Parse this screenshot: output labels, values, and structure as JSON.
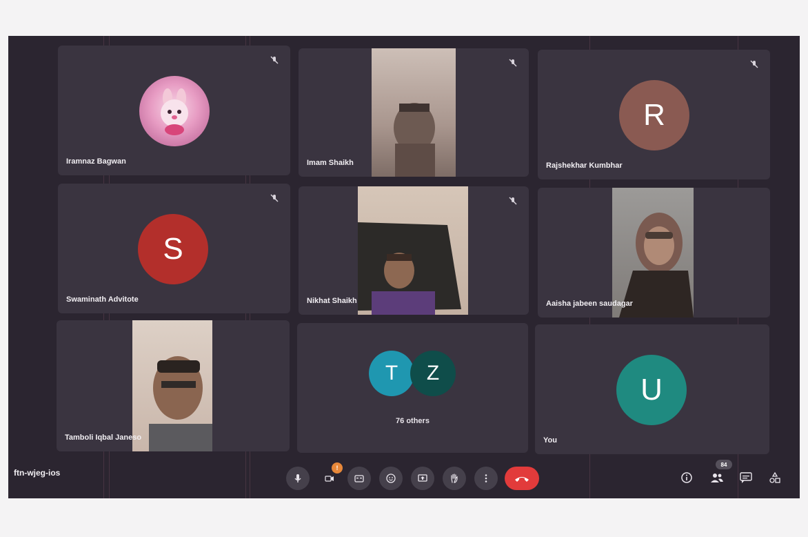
{
  "meeting_code": "ftn-wjeg-ios",
  "participants": [
    {
      "name": "Iramnaz Bagwan",
      "type": "image-avatar",
      "muted": true
    },
    {
      "name": "Imam Shaikh",
      "type": "video",
      "muted": true
    },
    {
      "name": "Rajshekhar Kumbhar",
      "type": "letter-avatar",
      "letter": "R",
      "color": "#8a5a52",
      "muted": true
    },
    {
      "name": "Swaminath Advitote",
      "type": "letter-avatar",
      "letter": "S",
      "color": "#b32f2b",
      "muted": true
    },
    {
      "name": "Nikhat Shaikh",
      "type": "video",
      "muted": true
    },
    {
      "name": "Aaisha jabeen saudagar",
      "type": "video",
      "muted": false
    },
    {
      "name": "Tamboli Iqbal Janeso",
      "type": "video",
      "muted": false
    },
    {
      "name": "You",
      "type": "letter-avatar",
      "letter": "U",
      "color": "#1f8a80",
      "muted": false
    }
  ],
  "others_tile": {
    "letters": [
      "T",
      "Z"
    ],
    "colors": [
      "#1f97b0",
      "#0f4d4a"
    ],
    "label": "76 others"
  },
  "controls": {
    "camera_badge": "!",
    "people_count": "84",
    "icons": [
      "mic-icon",
      "camera-off-icon",
      "captions-icon",
      "emoji-icon",
      "present-icon",
      "raise-hand-icon",
      "more-options-icon",
      "end-call-icon"
    ],
    "right_icons": [
      "info-icon",
      "people-icon",
      "chat-icon",
      "activities-icon"
    ]
  },
  "colors": {
    "background": "#2b2530",
    "tile": "#3a3440",
    "end_call": "#e23b3b",
    "badge": "#e8883a"
  }
}
